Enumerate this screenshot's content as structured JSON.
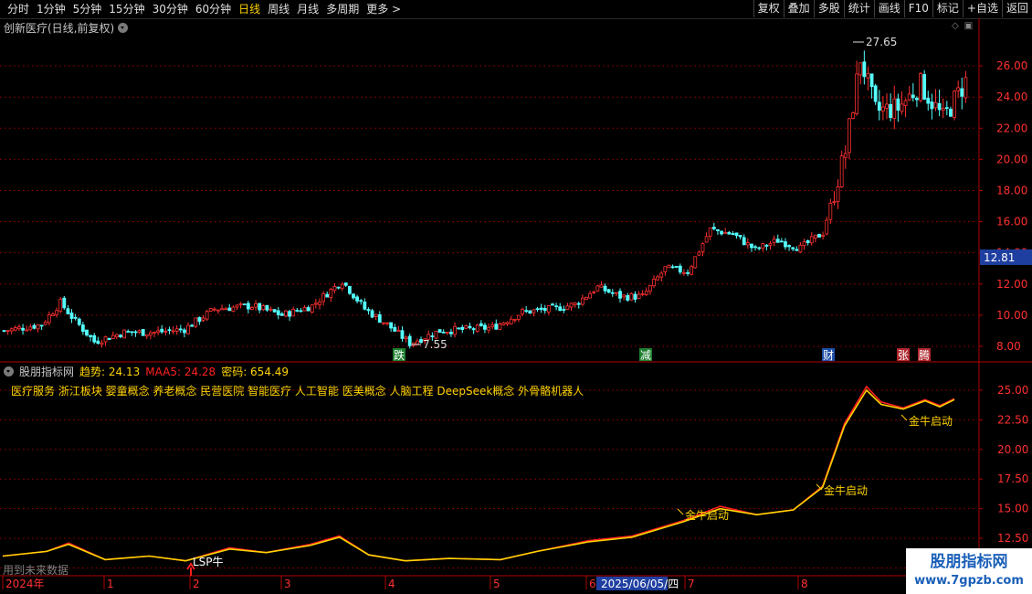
{
  "toolbar": {
    "periods": [
      "分时",
      "1分钟",
      "5分钟",
      "15分钟",
      "30分钟",
      "60分钟",
      "日线",
      "周线",
      "月线",
      "多周期",
      "更多 >"
    ],
    "active_index": 6,
    "actions": [
      "复权",
      "叠加",
      "多股",
      "统计",
      "画线",
      "F10",
      "标记",
      "+自选",
      "返回"
    ]
  },
  "main": {
    "title": "创新医疗(日线,前复权)",
    "high_label": "27.65",
    "low_label": "7.55",
    "current_price": "12.81",
    "event_tags": [
      {
        "text": "跌",
        "x": 437,
        "color": "#1e7e2e"
      },
      {
        "text": "减",
        "x": 707,
        "color": "#1e7e2e"
      },
      {
        "text": "财",
        "x": 907,
        "color": "#1f4fa8"
      },
      {
        "text": "张",
        "x": 989,
        "color": "#b0282e"
      },
      {
        "text": "腾",
        "x": 1012,
        "color": "#b0282e"
      }
    ]
  },
  "indicator": {
    "name": "股朋指标网",
    "trend_label": "趋势: 24.13",
    "maa_label": "MAA5: 24.28",
    "code_label": "密码: 654.49",
    "concepts": "医疗服务 浙江板块 婴童概念 养老概念 民营医院 智能医疗 人工智能 医美概念 人脑工程 DeepSeek概念 外骨骼机器人",
    "signals": [
      {
        "text": "金牛启动",
        "x": 748,
        "y": 563
      },
      {
        "text": "金牛启动",
        "x": 900,
        "y": 536
      },
      {
        "text": "金牛启动",
        "x": 993,
        "y": 460
      }
    ],
    "lsp_text": "LSP牛"
  },
  "hint": "用到未来数据",
  "time_axis": {
    "labels": [
      "2024年",
      "1",
      "2",
      "3",
      "4",
      "5",
      "6",
      "2025/06/05/四",
      "7",
      "8"
    ]
  },
  "watermark": {
    "line1": "股朋指标网",
    "line2": "www.7gpzb.com"
  },
  "colors": {
    "up": "#ff3030",
    "down": "#54ffff",
    "trend": "#ffd400",
    "maa": "#ff2020",
    "grid": "#7a0000",
    "axis": "#b00000"
  },
  "chart_data": [
    {
      "type": "candlestick",
      "title": "创新医疗(日线,前复权)",
      "ylim": [
        7.0,
        28.0
      ],
      "yticks": [
        8.0,
        10.0,
        12.0,
        14.0,
        16.0,
        18.0,
        20.0,
        22.0,
        24.0,
        26.0
      ],
      "y_tick_labels": [
        "8.00",
        "10.00",
        "12.00",
        "14.00",
        "16.00",
        "18.00",
        "20.00",
        "22.00",
        "24.00",
        "26.00"
      ],
      "key_points": [
        {
          "t": 0,
          "price": 9.0
        },
        {
          "t": 10,
          "price": 9.4
        },
        {
          "t": 15,
          "price": 10.8
        },
        {
          "t": 18,
          "price": 9.9
        },
        {
          "t": 24,
          "price": 8.3
        },
        {
          "t": 32,
          "price": 8.9
        },
        {
          "t": 40,
          "price": 8.9
        },
        {
          "t": 48,
          "price": 9.1
        },
        {
          "t": 56,
          "price": 10.4
        },
        {
          "t": 66,
          "price": 10.6
        },
        {
          "t": 74,
          "price": 10.0
        },
        {
          "t": 82,
          "price": 10.6
        },
        {
          "t": 90,
          "price": 12.2
        },
        {
          "t": 96,
          "price": 10.4
        },
        {
          "t": 102,
          "price": 9.4
        },
        {
          "t": 108,
          "price": 8.2
        },
        {
          "t": 116,
          "price": 9.0
        },
        {
          "t": 124,
          "price": 9.1
        },
        {
          "t": 130,
          "price": 9.2
        },
        {
          "t": 138,
          "price": 10.2
        },
        {
          "t": 146,
          "price": 10.4
        },
        {
          "t": 152,
          "price": 10.7
        },
        {
          "t": 158,
          "price": 11.8
        },
        {
          "t": 164,
          "price": 11.2
        },
        {
          "t": 170,
          "price": 11.2
        },
        {
          "t": 176,
          "price": 13.0
        },
        {
          "t": 182,
          "price": 12.8
        },
        {
          "t": 188,
          "price": 15.5
        },
        {
          "t": 194,
          "price": 15.2
        },
        {
          "t": 200,
          "price": 14.2
        },
        {
          "t": 206,
          "price": 14.8
        },
        {
          "t": 212,
          "price": 14.3
        },
        {
          "t": 218,
          "price": 15.3
        },
        {
          "t": 224,
          "price": 20.5
        },
        {
          "t": 228,
          "price": 26.5
        },
        {
          "t": 232,
          "price": 23.1
        },
        {
          "t": 238,
          "price": 23.3
        },
        {
          "t": 244,
          "price": 24.8
        },
        {
          "t": 250,
          "price": 22.6
        },
        {
          "t": 256,
          "price": 25.0
        }
      ]
    },
    {
      "type": "line",
      "title": "股朋指标网",
      "ylim": [
        9.5,
        26.0
      ],
      "yticks": [
        10.0,
        12.5,
        15.0,
        17.5,
        20.0,
        22.5,
        25.0
      ],
      "y_tick_labels": [
        "10.00",
        "12.50",
        "15.00",
        "17.50",
        "20.00",
        "22.50",
        "25.00"
      ],
      "series": [
        {
          "name": "趋势",
          "color": "#ffd400",
          "points": [
            [
              0,
              11.0
            ],
            [
              12,
              11.4
            ],
            [
              18,
              12.0
            ],
            [
              28,
              10.7
            ],
            [
              40,
              11.0
            ],
            [
              50,
              10.6
            ],
            [
              62,
              11.6
            ],
            [
              72,
              11.3
            ],
            [
              84,
              11.9
            ],
            [
              92,
              12.6
            ],
            [
              100,
              11.1
            ],
            [
              110,
              10.6
            ],
            [
              122,
              10.8
            ],
            [
              136,
              10.7
            ],
            [
              146,
              11.4
            ],
            [
              160,
              12.2
            ],
            [
              172,
              12.6
            ],
            [
              186,
              13.9
            ],
            [
              196,
              15.0
            ],
            [
              206,
              14.5
            ],
            [
              216,
              14.9
            ],
            [
              224,
              16.8
            ],
            [
              230,
              22.0
            ],
            [
              236,
              25.0
            ],
            [
              240,
              23.8
            ],
            [
              246,
              23.4
            ],
            [
              252,
              24.1
            ],
            [
              256,
              23.6
            ],
            [
              260,
              24.2
            ]
          ]
        },
        {
          "name": "MAA5",
          "color": "#ff2020",
          "points": [
            [
              0,
              11.0
            ],
            [
              12,
              11.4
            ],
            [
              18,
              12.1
            ],
            [
              28,
              10.7
            ],
            [
              40,
              11.0
            ],
            [
              50,
              10.6
            ],
            [
              62,
              11.7
            ],
            [
              72,
              11.3
            ],
            [
              84,
              12.0
            ],
            [
              92,
              12.7
            ],
            [
              100,
              11.1
            ],
            [
              110,
              10.6
            ],
            [
              122,
              10.8
            ],
            [
              136,
              10.7
            ],
            [
              146,
              11.4
            ],
            [
              160,
              12.3
            ],
            [
              172,
              12.7
            ],
            [
              186,
              14.0
            ],
            [
              196,
              15.2
            ],
            [
              206,
              14.5
            ],
            [
              216,
              14.9
            ],
            [
              224,
              16.9
            ],
            [
              230,
              22.2
            ],
            [
              236,
              25.3
            ],
            [
              240,
              24.0
            ],
            [
              246,
              23.5
            ],
            [
              252,
              24.2
            ],
            [
              256,
              23.7
            ],
            [
              260,
              24.28
            ]
          ]
        }
      ]
    }
  ]
}
